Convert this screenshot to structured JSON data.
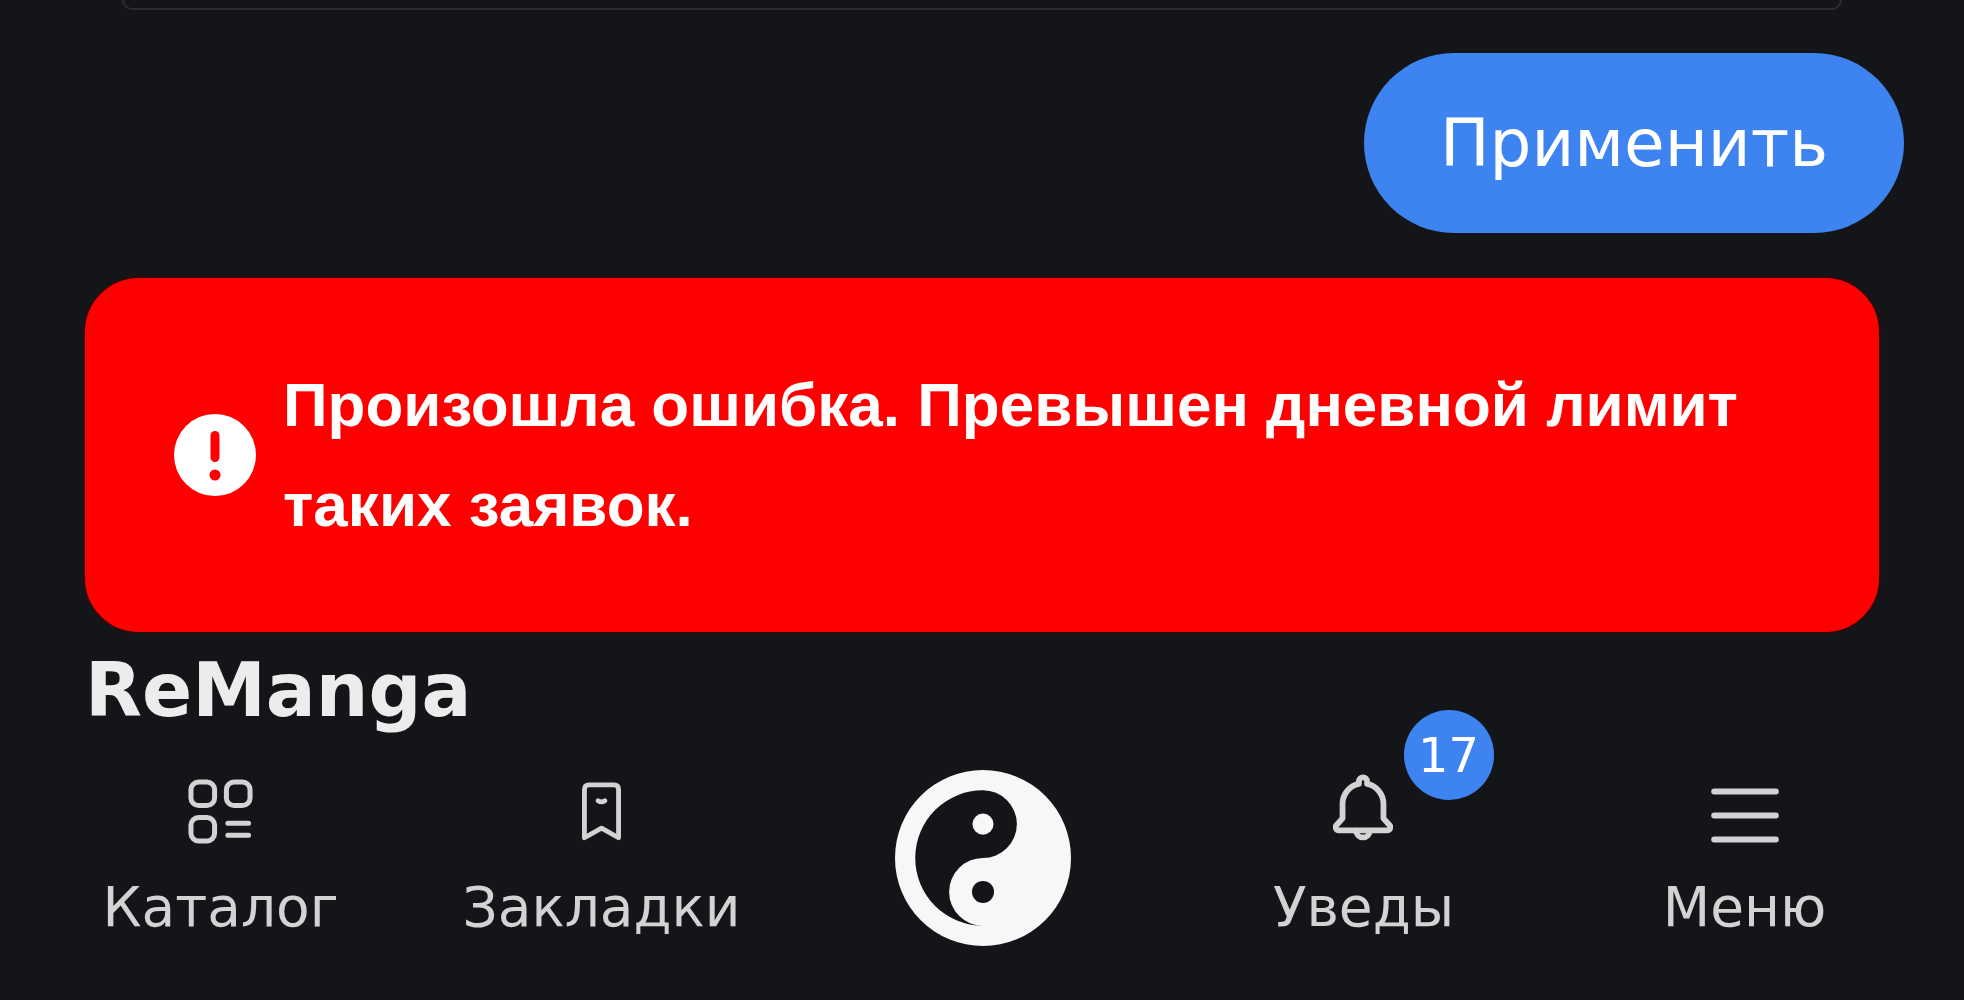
{
  "apply_button": {
    "label": "Применить"
  },
  "error_banner": {
    "message": "Произошла ошибка. Превышен дневной лимит таких заявок."
  },
  "app_title": "ReManga",
  "bottom_nav": {
    "items": [
      {
        "kind": "tab",
        "label": "Каталог"
      },
      {
        "kind": "tab",
        "label": "Закладки"
      },
      {
        "kind": "logo"
      },
      {
        "kind": "tab",
        "label": "Уведы",
        "badge": "17"
      },
      {
        "kind": "tab",
        "label": "Меню"
      }
    ]
  }
}
